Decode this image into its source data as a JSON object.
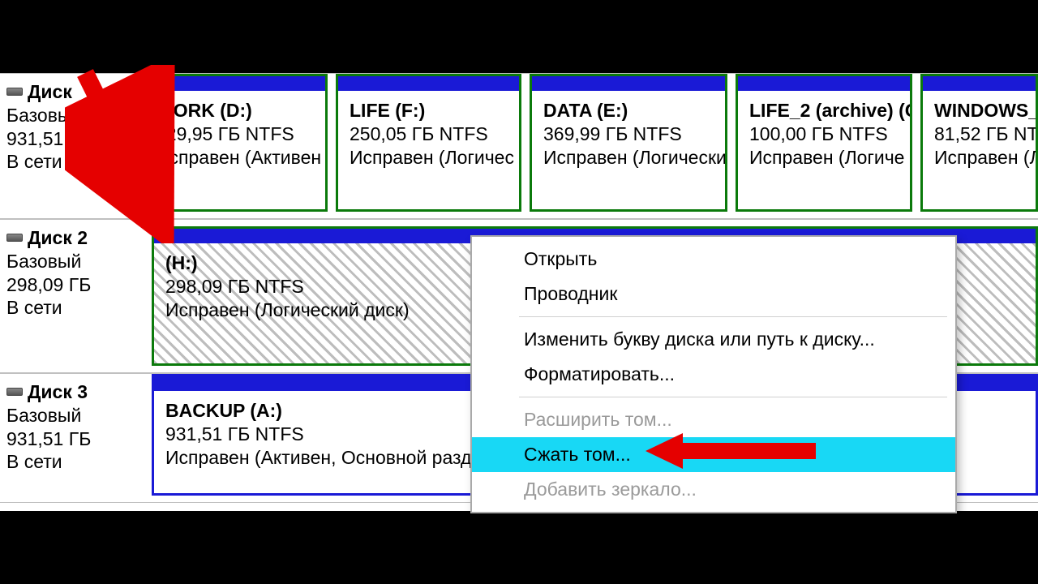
{
  "disks": [
    {
      "title": "Диск",
      "type": "Базовый",
      "size": "931,51 ГБ",
      "status": "В сети",
      "volumes": [
        {
          "name": "WORK  (D:)",
          "size": "129,95 ГБ NTFS",
          "state": "Исправен (Активен"
        },
        {
          "name": "LIFE  (F:)",
          "size": "250,05 ГБ NTFS",
          "state": "Исправен (Логичес"
        },
        {
          "name": "DATA  (E:)",
          "size": "369,99 ГБ NTFS",
          "state": "Исправен (Логически"
        },
        {
          "name": "LIFE_2 (archive)  (G",
          "size": "100,00 ГБ NTFS",
          "state": "Исправен (Логиче"
        },
        {
          "name": "WINDOWS_",
          "size": "81,52 ГБ NTF",
          "state": "Исправен (Л"
        }
      ]
    },
    {
      "title": "Диск 2",
      "type": "Базовый",
      "size": "298,09 ГБ",
      "status": "В сети",
      "volumes": [
        {
          "name": "(H:)",
          "size": "298,09 ГБ NTFS",
          "state": "Исправен (Логический диск)"
        }
      ]
    },
    {
      "title": "Диск 3",
      "type": "Базовый",
      "size": "931,51 ГБ",
      "status": "В сети",
      "volumes": [
        {
          "name": "BACKUP  (A:)",
          "size": "931,51 ГБ NTFS",
          "state": "Исправен (Активен, Основной разд"
        }
      ]
    }
  ],
  "context_menu": {
    "open": "Открыть",
    "explorer": "Проводник",
    "change_letter": "Изменить букву диска или путь к диску...",
    "format": "Форматировать...",
    "extend": "Расширить том...",
    "shrink": "Сжать том...",
    "mirror": "Добавить зеркало..."
  }
}
